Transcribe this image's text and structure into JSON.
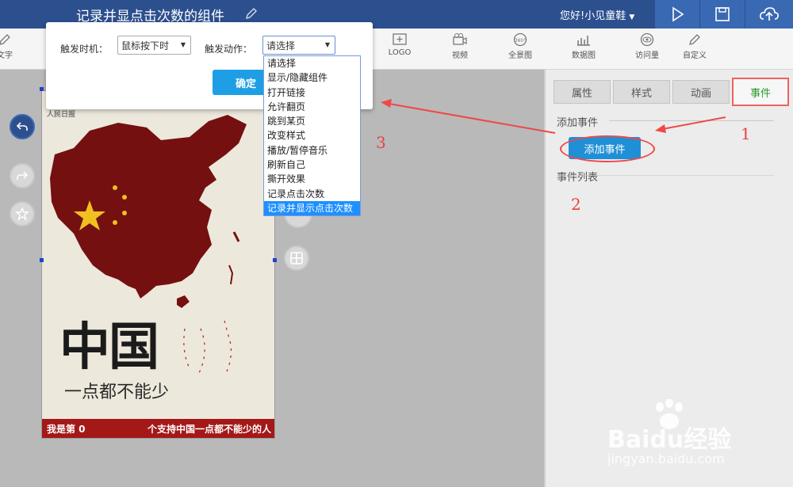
{
  "header": {
    "title": "记录并显点击次数的组件",
    "user": "您好!小见童鞋",
    "play_icon": "play-icon",
    "save_icon": "save-icon",
    "upload_icon": "upload-icon"
  },
  "toolbar": {
    "items": [
      {
        "label": "文字",
        "icon": "pencil-icon"
      },
      {
        "label": "LOGO",
        "icon": "logo-icon"
      },
      {
        "label": "视频",
        "icon": "video-icon"
      },
      {
        "label": "全景图",
        "icon": "panorama-icon"
      },
      {
        "label": "数据图",
        "icon": "chart-icon"
      },
      {
        "label": "访问量",
        "icon": "eye-icon"
      },
      {
        "label": "自定义",
        "icon": "pencil-icon"
      }
    ]
  },
  "modal": {
    "trigger_time_label": "触发时机：",
    "trigger_time_value": "鼠标按下时",
    "trigger_action_label": "触发动作：",
    "trigger_action_value": "请选择",
    "confirm_label": "确定"
  },
  "dropdown": {
    "options": [
      "请选择",
      "显示/隐藏组件",
      "打开链接",
      "允许翻页",
      "跳到某页",
      "改变样式",
      "播放/暂停音乐",
      "刷新自己",
      "撕开效果",
      "记录点击次数",
      "记录并显示点击次数"
    ],
    "selected_index": 10
  },
  "panel": {
    "tabs": [
      "属性",
      "样式",
      "动画",
      "事件"
    ],
    "active_tab": "事件",
    "add_event_section": "添加事件",
    "add_event_button": "添加事件",
    "event_list_section": "事件列表"
  },
  "phone": {
    "logo_text": "人民日报",
    "headline": "中国",
    "subline": "一点都不能少",
    "bottom_left": "我是第 0",
    "bottom_right": "个支持中国一点都不能少的人"
  },
  "annotations": [
    "1",
    "2",
    "3"
  ],
  "watermark": {
    "brand": "Baidu经验",
    "url": "jingyan.baidu.com"
  },
  "colors": {
    "header": "#2c4f8e",
    "accent": "#1e90ff",
    "annotation": "#e84040",
    "active_tab": "#2a9a2a"
  }
}
